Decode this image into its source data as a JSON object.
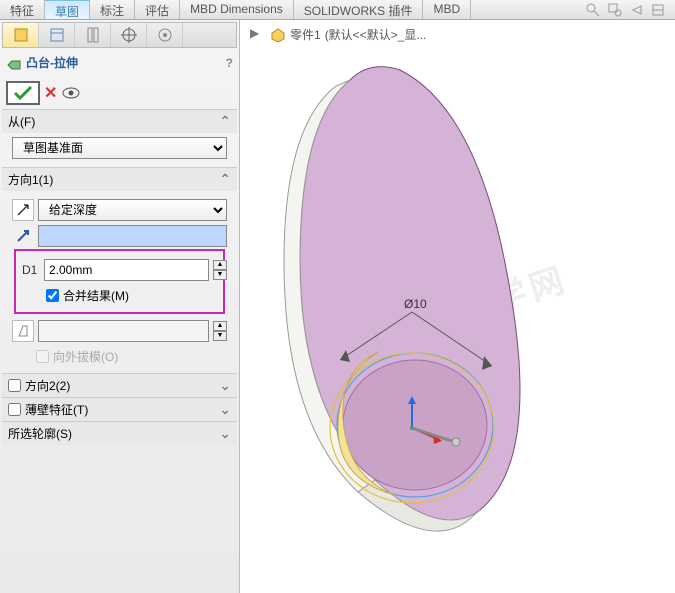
{
  "ribbon": {
    "tabs": [
      "特征",
      "草图",
      "标注",
      "评估",
      "MBD Dimensions",
      "SOLIDWORKS 插件",
      "MBD"
    ],
    "active_index": 1
  },
  "breadcrumb": {
    "part_name": "零件1",
    "config": "(默认<<默认>_显..."
  },
  "feature": {
    "title": "凸台-拉伸",
    "help_tooltip": "?"
  },
  "sections": {
    "from": {
      "header": "从(F)",
      "value": "草图基准面"
    },
    "dir1": {
      "header": "方向1(1)",
      "end_condition": "给定深度",
      "depth_value": "2.00mm",
      "merge_label": "合并结果(M)",
      "merge_checked": true,
      "draft_label": "向外拔模(O)",
      "draft_checked": false
    },
    "dir2": {
      "header": "方向2(2)",
      "enabled": false
    },
    "thin": {
      "header": "薄壁特征(T)",
      "enabled": false
    },
    "contours": {
      "header": "所选轮廓(S)"
    }
  },
  "viewport": {
    "dimension_label": "Ø10",
    "watermark": "软件自学网"
  }
}
